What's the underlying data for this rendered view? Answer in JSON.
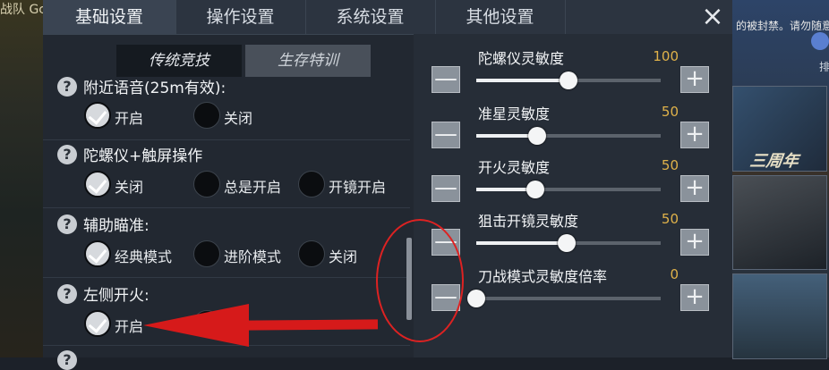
{
  "background": {
    "left_text": "战队 Gc",
    "right_text": "的被封禁。请勿随意",
    "anniversary": "三周年",
    "right_icon_label": "排"
  },
  "tabs": [
    {
      "label": "基础设置",
      "active": true
    },
    {
      "label": "操作设置",
      "active": false
    },
    {
      "label": "系统设置",
      "active": false
    },
    {
      "label": "其他设置",
      "active": false
    }
  ],
  "close_icon": "×",
  "subtabs": [
    {
      "label": "传统竞技",
      "active": false
    },
    {
      "label": "生存特训",
      "active": true
    }
  ],
  "settings": [
    {
      "label": "附近语音(25m有效):",
      "options": [
        "开启",
        "关闭"
      ],
      "selected": 0
    },
    {
      "label": "陀螺仪+触屏操作",
      "options": [
        "关闭",
        "总是开启",
        "开镜开启"
      ],
      "selected": 0
    },
    {
      "label": "辅助瞄准:",
      "options": [
        "经典模式",
        "进阶模式",
        "关闭"
      ],
      "selected": 0
    },
    {
      "label": "左侧开火:",
      "options": [
        "开启"
      ],
      "selected": 0
    }
  ],
  "help_icon": "?",
  "sliders": [
    {
      "label": "陀螺仪灵敏度",
      "value": "100",
      "fraction": 0.5
    },
    {
      "label": "准星灵敏度",
      "value": "50",
      "fraction": 0.33
    },
    {
      "label": "开火灵敏度",
      "value": "50",
      "fraction": 0.32
    },
    {
      "label": "狙击开镜灵敏度",
      "value": "50",
      "fraction": 0.49
    },
    {
      "label": "刀战模式灵敏度倍率",
      "value": "0",
      "fraction": 0.0
    }
  ],
  "minus_icon": "—",
  "plus_icon": "+",
  "colors": {
    "accent_value": "#e0b24a",
    "annotation_red": "#d61a1a"
  }
}
